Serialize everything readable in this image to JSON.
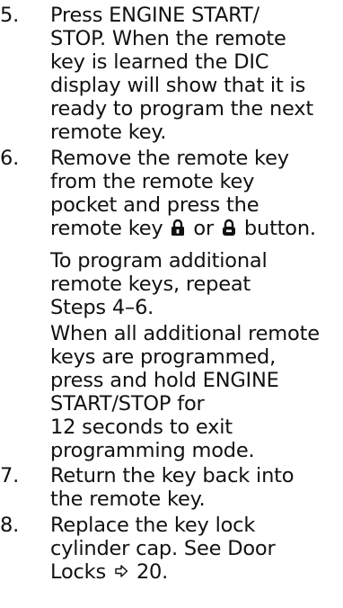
{
  "steps": [
    {
      "number": "5.",
      "text": "Press ENGINE START/\nSTOP. When the remote\nkey is learned the DIC\ndisplay will show that it is\nready to program the next\nremote key."
    },
    {
      "number": "6.",
      "text_lines": [
        "Remove the remote key",
        "from the remote key",
        "pocket and press the"
      ],
      "text_before_icons": "remote key ",
      "text_between_icons": " or ",
      "text_after_icons": " button."
    },
    {
      "number": "7.",
      "text": "Return the key back into\nthe remote key."
    },
    {
      "number": "8.",
      "text_lines": [
        "Replace the key lock",
        "cylinder cap. See Door"
      ],
      "link_text": "Locks",
      "page_ref": "20."
    }
  ],
  "notes": [
    {
      "text": "To program additional\nremote keys, repeat\nSteps 4–6."
    },
    {
      "text": "When all additional remote\nkeys are programmed,\npress and hold ENGINE\nSTART/STOP for\n12 seconds to exit\nprogramming mode."
    }
  ],
  "icons": {
    "lock": "lock-icon",
    "unlock": "unlock-icon",
    "page_ref": "arrow-ref-icon"
  }
}
